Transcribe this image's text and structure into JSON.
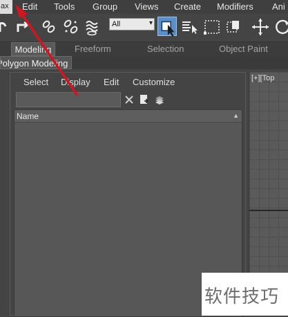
{
  "menubar": {
    "app_fragment": "ax",
    "items": [
      "Edit",
      "Tools",
      "Group",
      "Views",
      "Create",
      "Modifiers",
      "Ani"
    ]
  },
  "toolbar": {
    "selection_filter": "All"
  },
  "ribbon": {
    "tabs": [
      "Modeling",
      "Freeform",
      "Selection",
      "Object Paint"
    ],
    "active_tab": "Modeling",
    "subtab": "Polygon Modeling"
  },
  "scene_explorer": {
    "menu": [
      "Select",
      "Display",
      "Edit",
      "Customize"
    ],
    "search_value": "",
    "column_header": "Name"
  },
  "viewport": {
    "label": "[+][Top"
  },
  "watermark": {
    "text": "软件技巧"
  },
  "colors": {
    "arrow": "#d0161e",
    "active_tool": "#5b8fc7"
  }
}
